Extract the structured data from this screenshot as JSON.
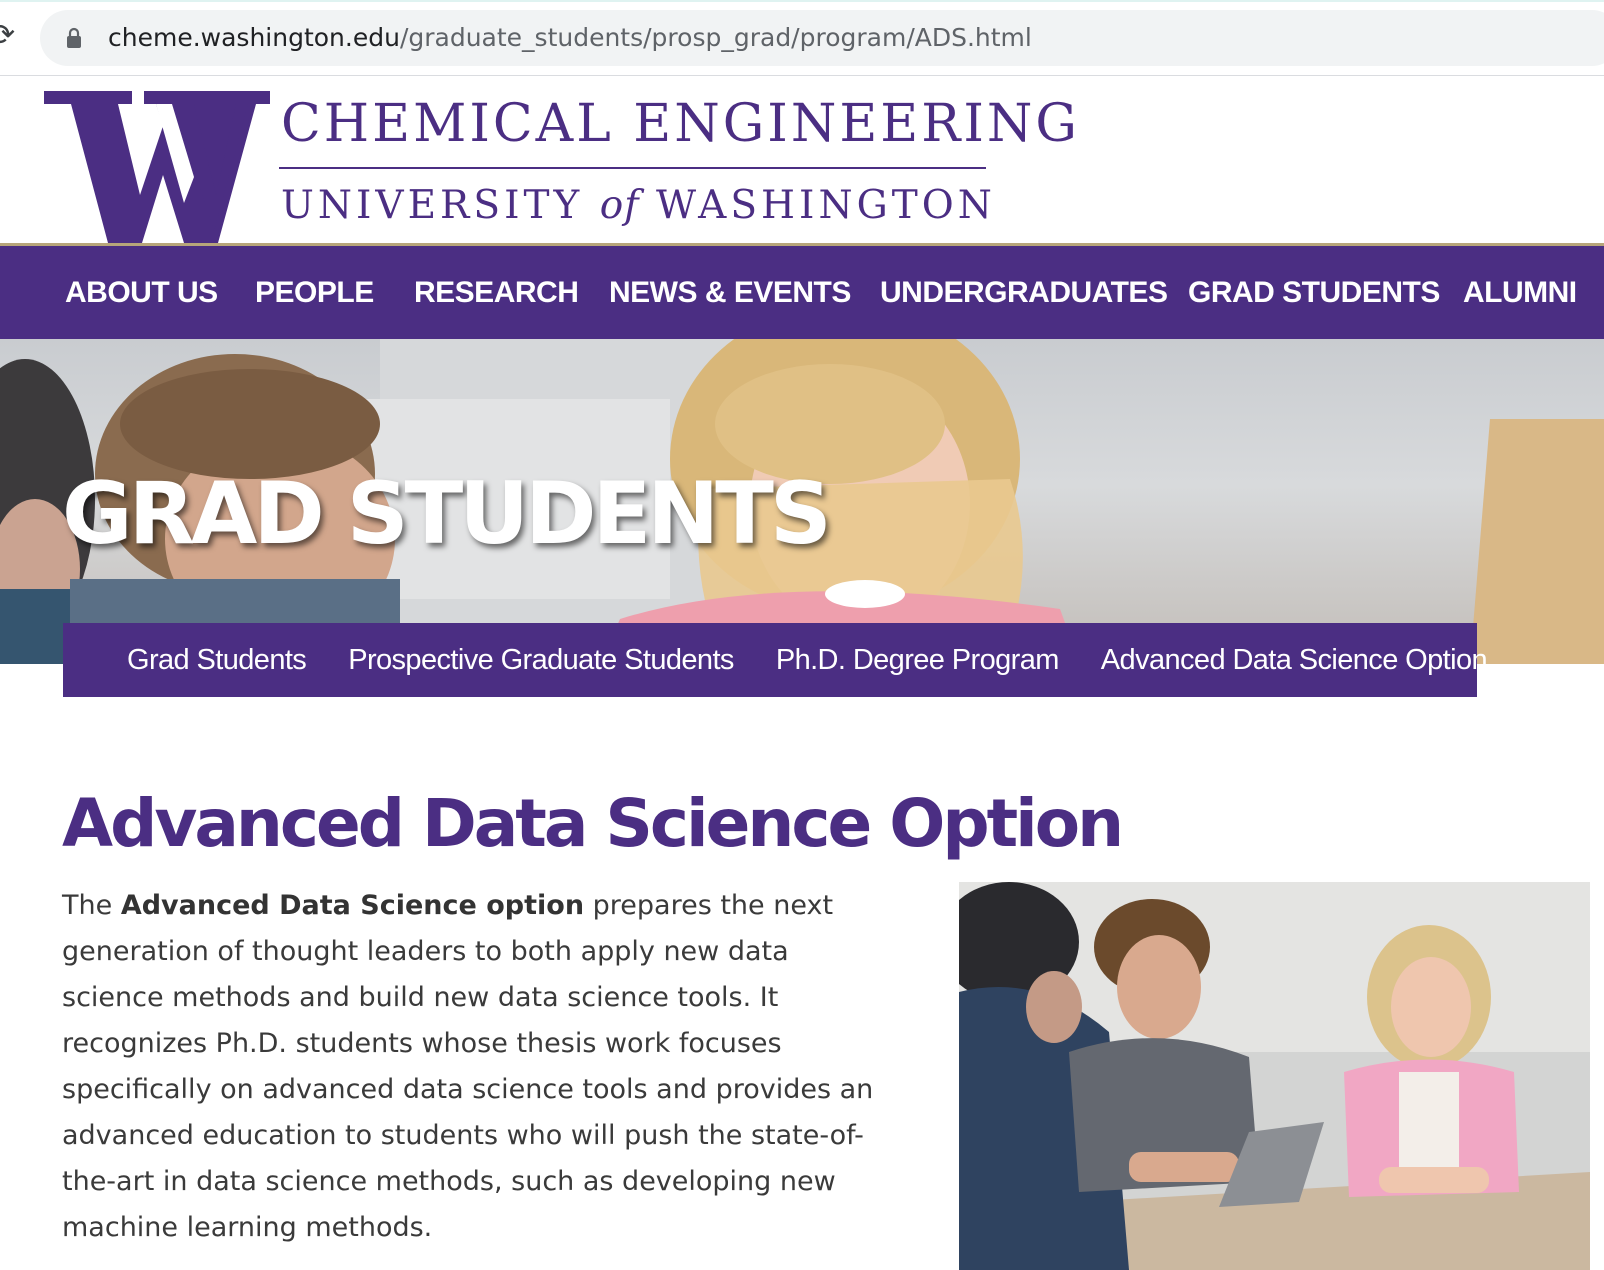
{
  "browser": {
    "url_host": "cheme.washington.edu",
    "url_path": "/graduate_students/prosp_grad/program/ADS.html"
  },
  "header": {
    "logo_letter": "W",
    "department": "CHEMICAL ENGINEERING",
    "university_pre": "UNIVERSITY",
    "university_of": "of",
    "university_post": "WASHINGTON"
  },
  "nav": {
    "items": [
      "ABOUT US",
      "PEOPLE",
      "RESEARCH",
      "NEWS & EVENTS",
      "UNDERGRADUATES",
      "GRAD STUDENTS",
      "ALUMNI"
    ]
  },
  "hero": {
    "title": "GRAD STUDENTS"
  },
  "breadcrumb": {
    "items": [
      "Grad Students",
      "Prospective Graduate Students",
      "Ph.D. Degree Program",
      "Advanced Data Science Option"
    ]
  },
  "main": {
    "title": "Advanced Data Science Option",
    "intro_pre": "The ",
    "intro_bold": "Advanced Data Science option",
    "intro_post": " prepares the next generation of thought leaders to both apply new data science methods and build new data science tools. It recognizes Ph.D. students whose thesis work focuses specifically on advanced data science tools and provides an advanced education to students who will push the state-of-the-art in data science methods, such as developing new machine learning methods."
  },
  "colors": {
    "uw_purple": "#4b2e83",
    "uw_gold": "#b7a57a"
  },
  "icons": [
    "reload-icon",
    "lock-icon",
    "home-icon",
    "chevron-right-icon"
  ]
}
